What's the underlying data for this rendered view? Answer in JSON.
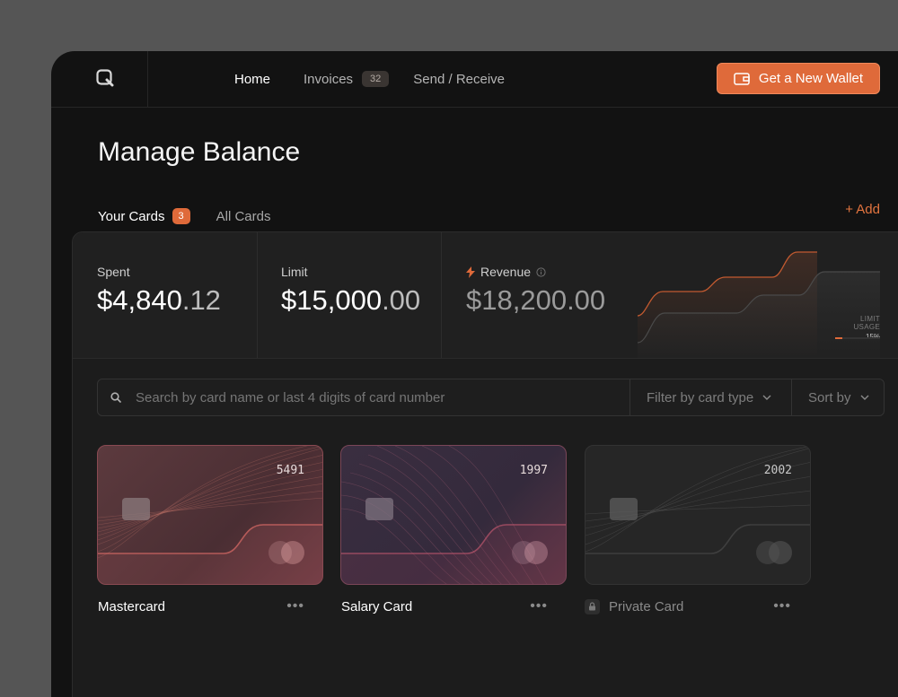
{
  "nav": {
    "home": "Home",
    "invoices": "Invoices",
    "invoices_count": "32",
    "send_receive": "Send / Receive",
    "cta": "Get a New Wallet"
  },
  "page": {
    "title": "Manage Balance",
    "tabs": [
      {
        "label": "Your Cards",
        "badge": "3"
      },
      {
        "label": "All Cards"
      }
    ],
    "add_label": "+ Add"
  },
  "stats": {
    "spent": {
      "label": "Spent",
      "whole": "$4,840",
      "cents": ".12"
    },
    "limit": {
      "label": "Limit",
      "whole": "$15,000",
      "cents": ".00"
    },
    "revenue": {
      "label": "Revenue",
      "whole": "$18,200",
      "cents": ".00"
    },
    "limit_usage": {
      "label": "LIMIT USAGE",
      "percent": "15%",
      "fraction": 0.15
    }
  },
  "search": {
    "placeholder": "Search by card name or last 4 digits of card number",
    "filter_label": "Filter by card type",
    "sort_label": "Sort by"
  },
  "cards": [
    {
      "name": "Mastercard",
      "last4": "5491",
      "locked": false
    },
    {
      "name": "Salary Card",
      "last4": "1997",
      "locked": false
    },
    {
      "name": "Private Card",
      "last4": "2002",
      "locked": true
    }
  ],
  "colors": {
    "accent": "#df6a3a",
    "background": "#121212",
    "panel": "#1c1c1c"
  },
  "icons": {
    "logo": "logo-icon",
    "wallet": "wallet-icon",
    "search": "search-icon",
    "chevron": "chevron-down-icon",
    "bolt": "bolt-icon",
    "info": "info-icon",
    "lock": "lock-icon",
    "more": "more-icon"
  }
}
